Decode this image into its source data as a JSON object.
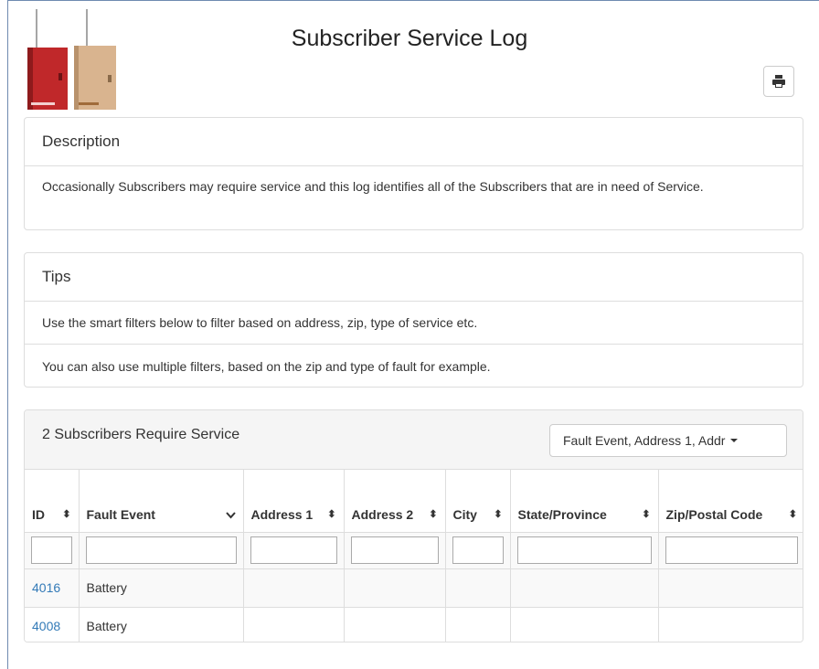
{
  "page": {
    "title": "Subscriber Service Log"
  },
  "description": {
    "heading": "Description",
    "body": "Occasionally Subscribers may require service and this log identifies all of the Subscribers that are in need of Service."
  },
  "tips": {
    "heading": "Tips",
    "items": [
      "Use the smart filters below to filter based on address, zip, type of service etc.",
      "You can also use multiple filters, based on the zip and type of fault for example."
    ]
  },
  "table": {
    "count_title": "2 Subscribers Require Service",
    "columns_dropdown_label": "Fault Event, Address 1, Addr",
    "columns": [
      "ID",
      "Fault Event",
      "Address 1",
      "Address 2",
      "City",
      "State/Province",
      "Zip/Postal Code"
    ],
    "rows": [
      {
        "id": "4016",
        "fault_event": "Battery",
        "address1": "",
        "address2": "",
        "city": "",
        "state": "",
        "zip": ""
      },
      {
        "id": "4008",
        "fault_event": "Battery",
        "address1": "",
        "address2": "",
        "city": "",
        "state": "",
        "zip": ""
      }
    ]
  },
  "icons": {
    "print": "print-icon",
    "sort": "sort-icon",
    "filter_dropdown": "chevron-down-icon",
    "caret": "caret-down-icon"
  },
  "colors": {
    "link": "#337ab7",
    "border": "#dddddd",
    "heading_bg": "#f5f5f5",
    "device_red": "#c0282a",
    "device_tan": "#d9b48f"
  }
}
